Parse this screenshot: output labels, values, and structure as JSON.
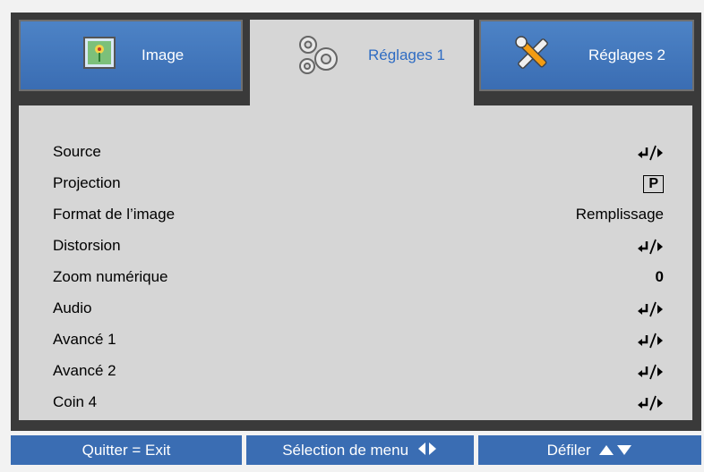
{
  "tabs": [
    {
      "label": "Image",
      "icon": "picture-icon",
      "active": false
    },
    {
      "label": "Réglages 1",
      "icon": "gears-icon",
      "active": true
    },
    {
      "label": "Réglages 2",
      "icon": "tools-icon",
      "active": false
    }
  ],
  "menu": [
    {
      "label": "Source",
      "value": "",
      "value_icon": "enter-arrow-icon"
    },
    {
      "label": "Projection",
      "value": "P",
      "value_icon": "projection-front-icon"
    },
    {
      "label": "Format de l’image",
      "value": "Remplissage",
      "value_icon": ""
    },
    {
      "label": "Distorsion",
      "value": "",
      "value_icon": "enter-arrow-icon"
    },
    {
      "label": "Zoom numérique",
      "value": "0",
      "value_icon": ""
    },
    {
      "label": "Audio",
      "value": "",
      "value_icon": "enter-arrow-icon"
    },
    {
      "label": "Avancé 1",
      "value": "",
      "value_icon": "enter-arrow-icon"
    },
    {
      "label": "Avancé 2",
      "value": "",
      "value_icon": "enter-arrow-icon"
    },
    {
      "label": "Coin 4",
      "value": "",
      "value_icon": "enter-arrow-icon"
    }
  ],
  "footer": {
    "exit": "Quitter = Exit",
    "select": "Sélection de menu",
    "scroll": "Défiler"
  },
  "colors": {
    "frame": "#3a3a3a",
    "panel": "#d6d6d6",
    "tab_blue": "#3a6db3",
    "active_text": "#2f6cc3"
  }
}
